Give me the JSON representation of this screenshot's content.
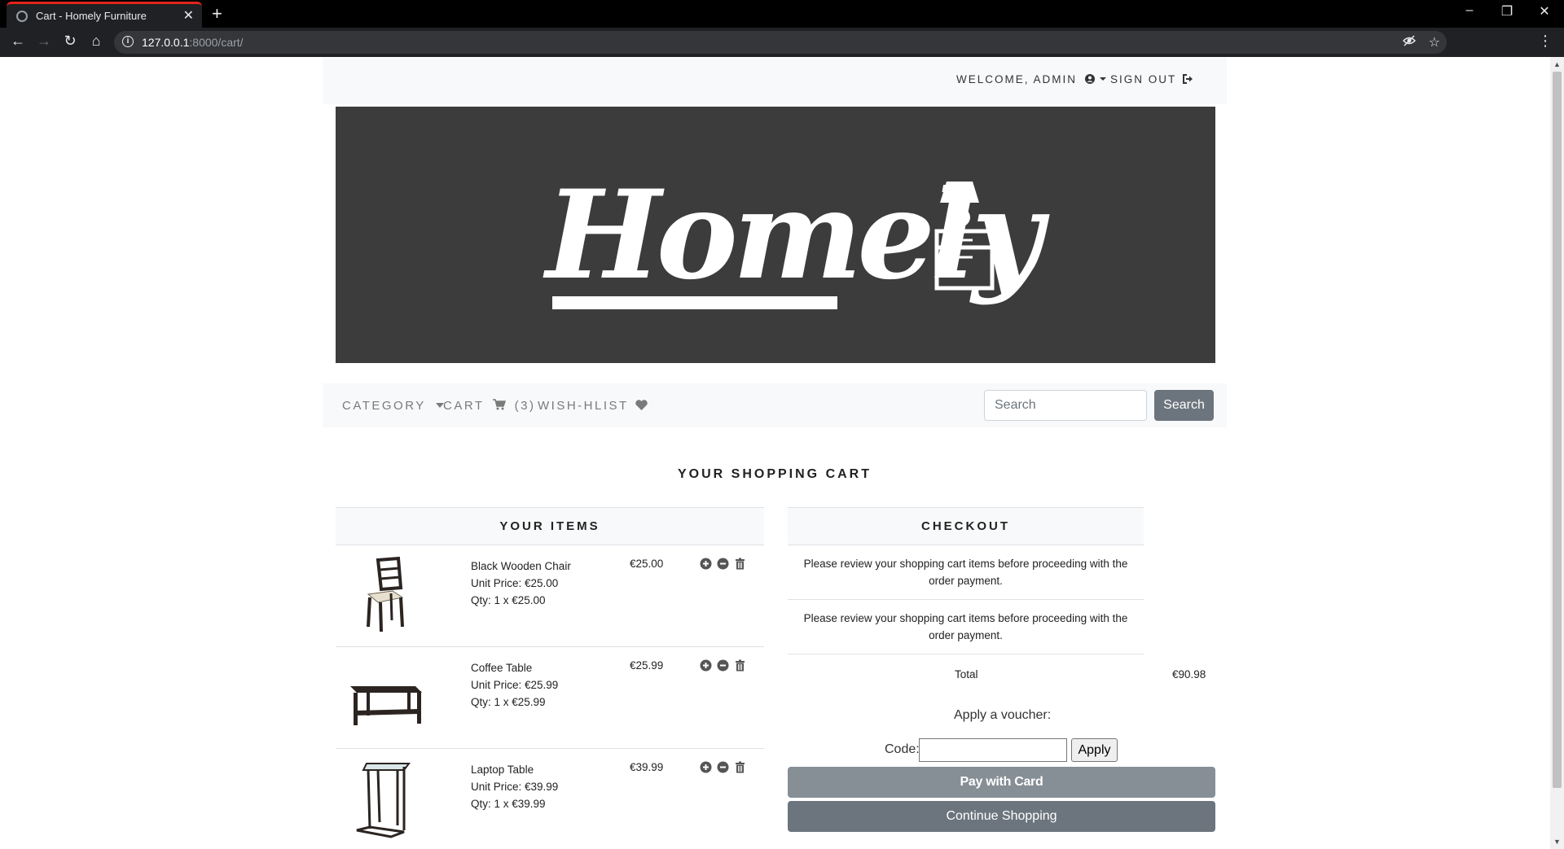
{
  "browser": {
    "tab_title": "Cart - Homely Furniture",
    "url_host": "127.0.0.1",
    "url_path": ":8000/cart/"
  },
  "topnav": {
    "welcome": "WELCOME, ADMIN",
    "sign_out": "SIGN OUT"
  },
  "banner": {
    "brand": "Homely"
  },
  "mainnav": {
    "category": "CATEGORY",
    "cart": "CART",
    "cart_count": "(3)",
    "wishlist": "WISH-HLIST",
    "search_placeholder": "Search",
    "search_button": "Search"
  },
  "page": {
    "heading": "YOUR SHOPPING CART"
  },
  "items_panel": {
    "title": "YOUR ITEMS",
    "items": [
      {
        "name": "Black Wooden Chair",
        "unit_price": "Unit Price: €25.00",
        "qty": "Qty: 1 x €25.00",
        "price": "€25.00",
        "icon": "chair-image"
      },
      {
        "name": "Coffee Table",
        "unit_price": "Unit Price: €25.99",
        "qty": "Qty: 1 x €25.99",
        "price": "€25.99",
        "icon": "coffee-table-image"
      },
      {
        "name": "Laptop Table",
        "unit_price": "Unit Price: €39.99",
        "qty": "Qty: 1 x €39.99",
        "price": "€39.99",
        "icon": "laptop-table-image"
      }
    ]
  },
  "checkout": {
    "title": "CHECKOUT",
    "message_1": "Please review your shopping cart items before proceeding with the order payment.",
    "message_2": "Please review your shopping cart items before proceeding with the order payment.",
    "total_label": "Total",
    "total_value": "€90.98",
    "voucher_title": "Apply a voucher:",
    "code_label": "Code:",
    "apply_button": "Apply",
    "pay_button": "Pay with Card",
    "continue_button": "Continue Shopping"
  },
  "colors": {
    "banner_bg": "#3b3c3b",
    "tab_accent": "#e2241b",
    "button_secondary": "#6c757d"
  }
}
